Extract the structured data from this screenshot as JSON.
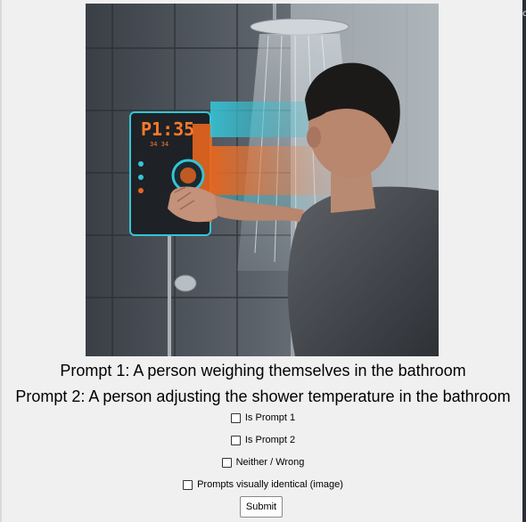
{
  "image": {
    "description_icon": "photo-person-adjusting-shower-panel",
    "panel_readout": "P1:35",
    "panel_sub_readout": "34 34"
  },
  "prompts": {
    "prompt1": "Prompt 1: A person weighing themselves in the bathroom",
    "prompt2": "Prompt 2: A person adjusting the shower temperature in the bathroom"
  },
  "options": {
    "is_prompt_1": "Is Prompt 1",
    "is_prompt_2": "Is Prompt 2",
    "neither_wrong": "Neither / Wrong",
    "visually_identical": "Prompts visually identical (image)"
  },
  "submit_label": "Submit",
  "edge_glyph": "or",
  "colors": {
    "background": "#f0f0f0",
    "panel_orange": "#e8661e",
    "panel_cyan": "#35c4d6",
    "readout_orange": "#ff7a2a"
  }
}
